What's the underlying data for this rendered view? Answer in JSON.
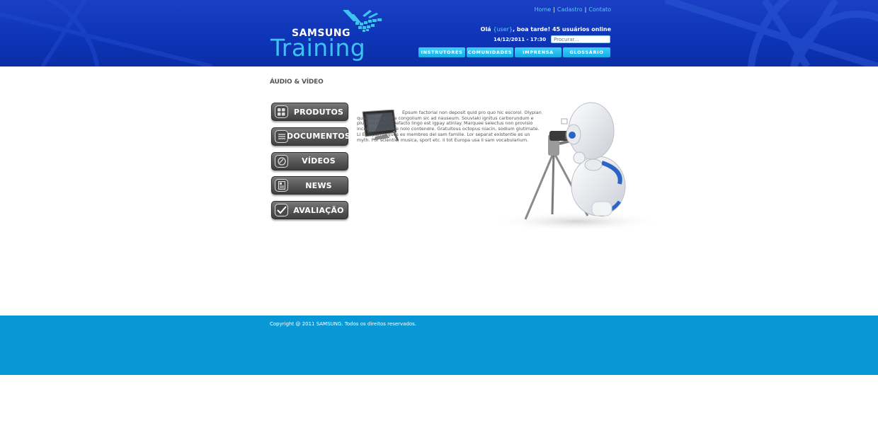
{
  "header": {
    "logo": {
      "brand": "SAMSUNG",
      "product": "Training"
    },
    "links": [
      {
        "label": "Home"
      },
      {
        "label": "Cadastro"
      },
      {
        "label": "Contato"
      }
    ],
    "greeting": {
      "prefix": "Olá ",
      "user": "{user}",
      "suffix": ", boa tarde! 45 usuários online"
    },
    "datetime": "14/12/2011 - 17:30",
    "search": {
      "placeholder": "Procurar..."
    },
    "nav": [
      {
        "label": "INSTRUTORES"
      },
      {
        "label": "COMUNIDADES"
      },
      {
        "label": "IMPRENSA"
      },
      {
        "label": "GLOSSÁRIO"
      }
    ]
  },
  "main": {
    "section_title": "ÁUDIO & VÍDEO",
    "menu": [
      {
        "label": "PRODUTOS",
        "icon": "grid-icon"
      },
      {
        "label": "DOCUMENTOS",
        "icon": "document-icon"
      },
      {
        "label": "VÍDEOS",
        "icon": "video-icon"
      },
      {
        "label": "NEWS",
        "icon": "news-icon"
      },
      {
        "label": "AVALIAÇÃO",
        "icon": "checkmark-icon"
      }
    ],
    "body_text": "Epsum factorial non deposit quid pro quo hic escorol. Olypian quarrels et gorilla congolium sic ad nauseum. Souvlaki ignitus carborundum e pluribus unum. Defacto lingo est igpay atinlay. Marquee selectus non provisio incongruous feline nolo contendre. Gratuitous octopus niacin, sodium glutimate. Li Europan lingues es membres del sam familie. Lor separat existentie es un myth. Por scientie, musica, sport etc. li tot Europa usa li sam vocabularium."
  },
  "footer": {
    "copyright": "Copyright @ 2011 SAMSUNG. Todos os direitos reservados."
  },
  "colors": {
    "header_blue": "#0e35b8",
    "accent_cyan": "#3dc3f0",
    "nav_cyan": "#12aee6",
    "footer_blue": "#0a97d6",
    "menu_gray": "#5b5b5b"
  }
}
